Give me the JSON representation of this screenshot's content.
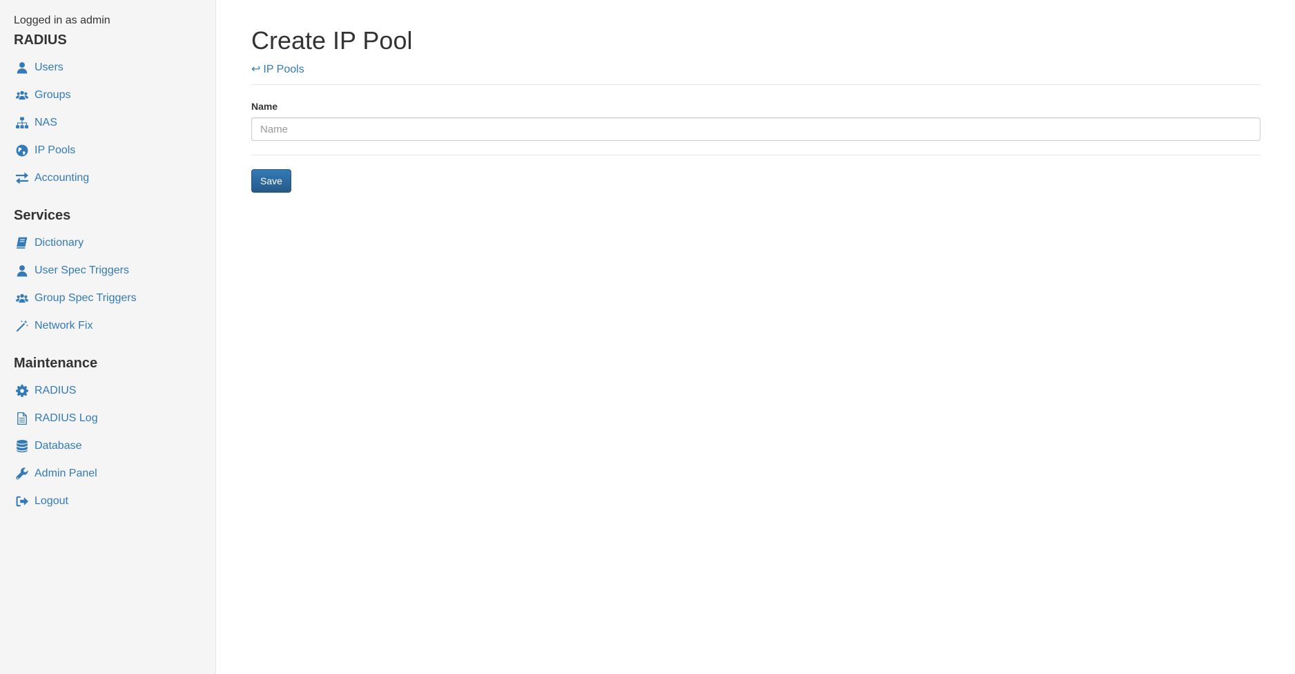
{
  "sidebar": {
    "logged_in": "Logged in as admin",
    "sections": [
      {
        "title": "RADIUS",
        "items": [
          {
            "label": "Users",
            "icon": "user-icon"
          },
          {
            "label": "Groups",
            "icon": "users-icon"
          },
          {
            "label": "NAS",
            "icon": "sitemap-icon"
          },
          {
            "label": "IP Pools",
            "icon": "globe-icon"
          },
          {
            "label": "Accounting",
            "icon": "exchange-icon"
          }
        ]
      },
      {
        "title": "Services",
        "items": [
          {
            "label": "Dictionary",
            "icon": "book-icon"
          },
          {
            "label": "User Spec Triggers",
            "icon": "user-icon"
          },
          {
            "label": "Group Spec Triggers",
            "icon": "users-icon"
          },
          {
            "label": "Network Fix",
            "icon": "magic-wand-icon"
          }
        ]
      },
      {
        "title": "Maintenance",
        "items": [
          {
            "label": "RADIUS",
            "icon": "gear-icon"
          },
          {
            "label": "RADIUS Log",
            "icon": "file-text-icon"
          },
          {
            "label": "Database",
            "icon": "database-icon"
          },
          {
            "label": "Admin Panel",
            "icon": "wrench-icon"
          },
          {
            "label": "Logout",
            "icon": "sign-out-icon"
          }
        ]
      }
    ]
  },
  "main": {
    "title": "Create IP Pool",
    "back_arrow": "↩",
    "back_label": "IP Pools",
    "form": {
      "name_label": "Name",
      "name_value": "",
      "name_placeholder": "Name",
      "save_label": "Save"
    }
  },
  "colors": {
    "link": "#337ab7",
    "sidebar_bg": "#f5f5f5",
    "button": "#337ab7"
  }
}
